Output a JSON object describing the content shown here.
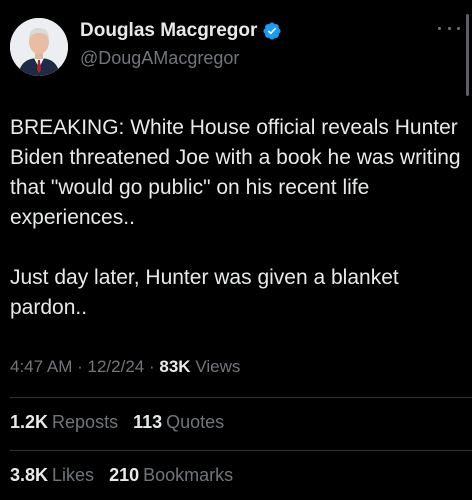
{
  "author": {
    "name": "Douglas Macgregor",
    "handle": "@DougAMacgregor",
    "verified_icon": "verified-badge-icon",
    "verified_color": "#1d9bf0"
  },
  "tweet": {
    "paragraphs": [
      "BREAKING:  White House official reveals Hunter Biden threatened Joe with a book he was writing that \"would go public\" on his recent life experiences..",
      "Just day later, Hunter was given a blanket pardon.."
    ]
  },
  "meta": {
    "time": "4:47 AM",
    "date": "12/2/24",
    "views_count": "83K",
    "views_label": "Views",
    "separator": "·"
  },
  "stats": {
    "reposts_count": "1.2K",
    "reposts_label": "Reposts",
    "quotes_count": "113",
    "quotes_label": "Quotes",
    "likes_count": "3.8K",
    "likes_label": "Likes",
    "bookmarks_count": "210",
    "bookmarks_label": "Bookmarks"
  },
  "colors": {
    "background": "#000000",
    "text_primary": "#e7e9ea",
    "text_secondary": "#71767b",
    "divider": "#2f3336"
  }
}
